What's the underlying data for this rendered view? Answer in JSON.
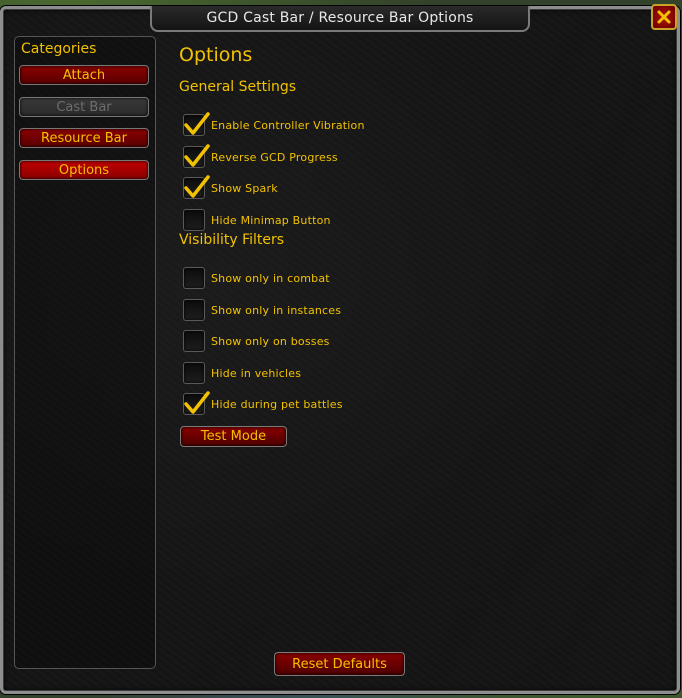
{
  "window": {
    "title": "GCD Cast Bar / Resource Bar Options"
  },
  "categories": {
    "title": "Categories",
    "items": [
      {
        "label": "Attach",
        "state": "normal"
      },
      {
        "label": "Cast Bar",
        "state": "disabled"
      },
      {
        "label": "Resource Bar",
        "state": "normal"
      },
      {
        "label": "Options",
        "state": "active"
      }
    ]
  },
  "options": {
    "title": "Options",
    "general_title": "General Settings",
    "general": [
      {
        "label": "Enable Controller Vibration",
        "checked": true
      },
      {
        "label": "Reverse GCD Progress",
        "checked": true
      },
      {
        "label": "Show Spark",
        "checked": true
      },
      {
        "label": "Hide Minimap Button",
        "checked": false
      }
    ],
    "visibility_title": "Visibility Filters",
    "visibility": [
      {
        "label": "Show only in combat",
        "checked": false
      },
      {
        "label": "Show only in instances",
        "checked": false
      },
      {
        "label": "Show only on bosses",
        "checked": false
      },
      {
        "label": "Hide in vehicles",
        "checked": false
      },
      {
        "label": "Hide during pet battles",
        "checked": true
      }
    ],
    "test_mode_label": "Test Mode",
    "reset_label": "Reset Defaults"
  },
  "colors": {
    "text_gold": "#f2c200",
    "button_red": "#8a0000",
    "disabled_text": "#6d6d6d"
  }
}
